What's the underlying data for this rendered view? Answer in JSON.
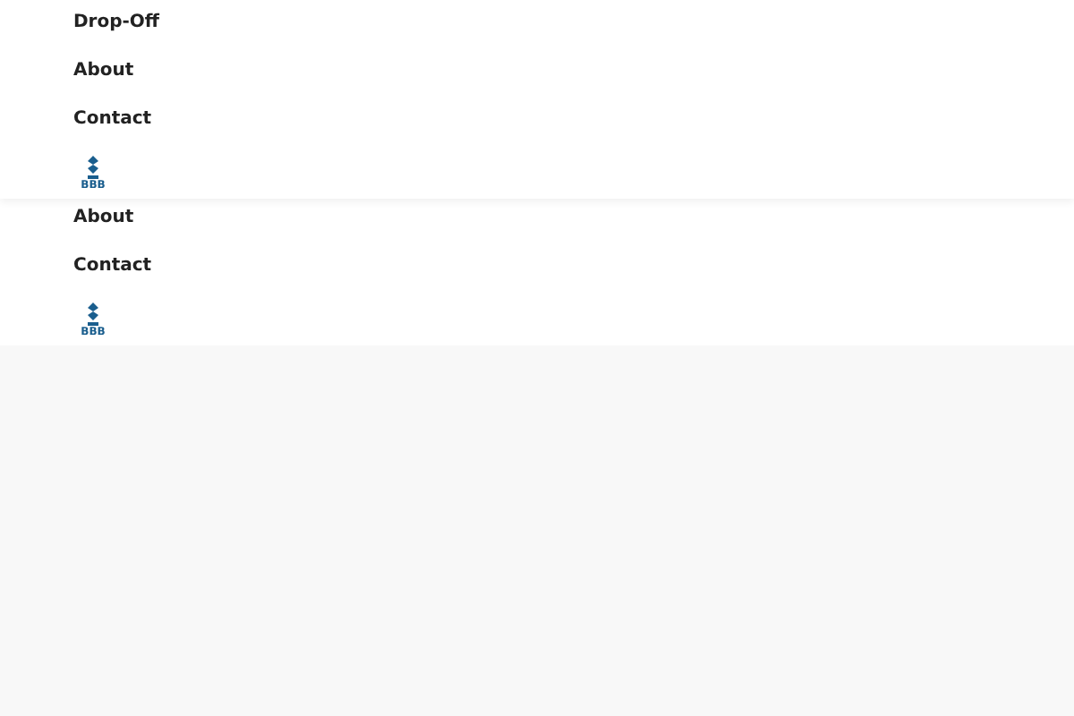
{
  "menus": [
    {
      "links": [
        "Drop-Off",
        "About",
        "Contact"
      ],
      "badge_text": "BBB"
    },
    {
      "links": [
        "About",
        "Contact"
      ],
      "badge_text": "BBB"
    }
  ]
}
